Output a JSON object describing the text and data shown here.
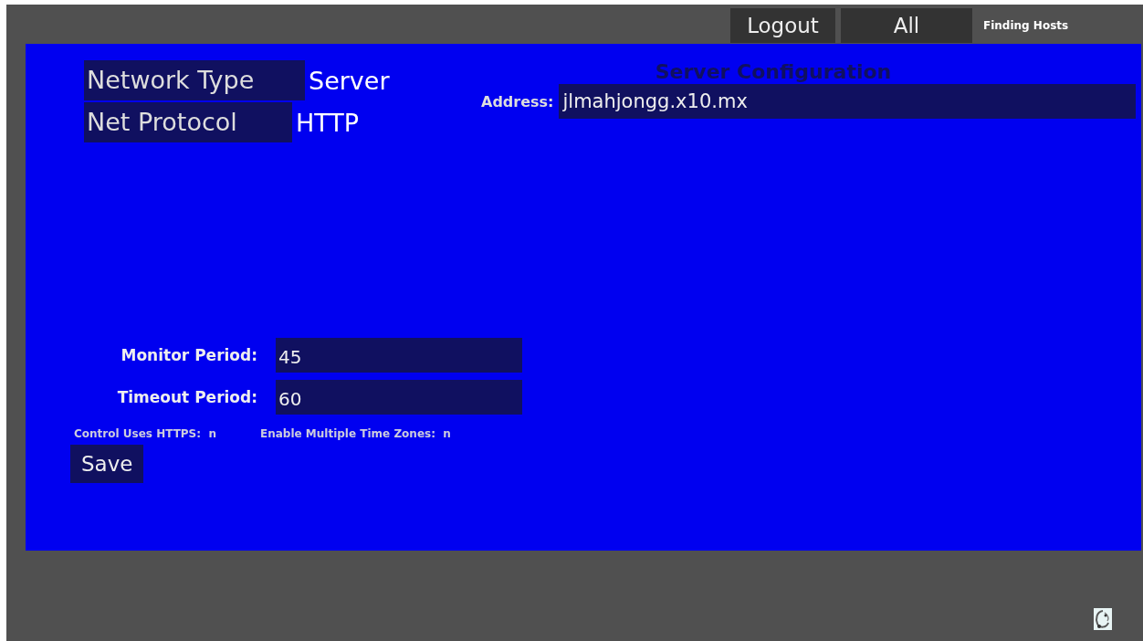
{
  "top_bar": {
    "buttons": [
      {
        "label": "Logout"
      },
      {
        "label": "All"
      }
    ],
    "status": "Finding Hosts"
  },
  "settings": [
    {
      "label": "Network Type",
      "value": "Server"
    },
    {
      "label": "Net Protocol",
      "value": "HTTP"
    }
  ],
  "server_configuration": {
    "title": "Server Configuration",
    "address_label": "Address:",
    "address_value": "jlmahjongg.x10.mx"
  },
  "periods": [
    {
      "label": "Monitor Period:",
      "value": "45"
    },
    {
      "label": "Timeout Period:",
      "value": "60"
    }
  ],
  "flags": [
    {
      "label": "Control Uses HTTPS:",
      "value": "n"
    },
    {
      "label": "Enable Multiple Time Zones:",
      "value": "n"
    }
  ],
  "save_button": "Save"
}
